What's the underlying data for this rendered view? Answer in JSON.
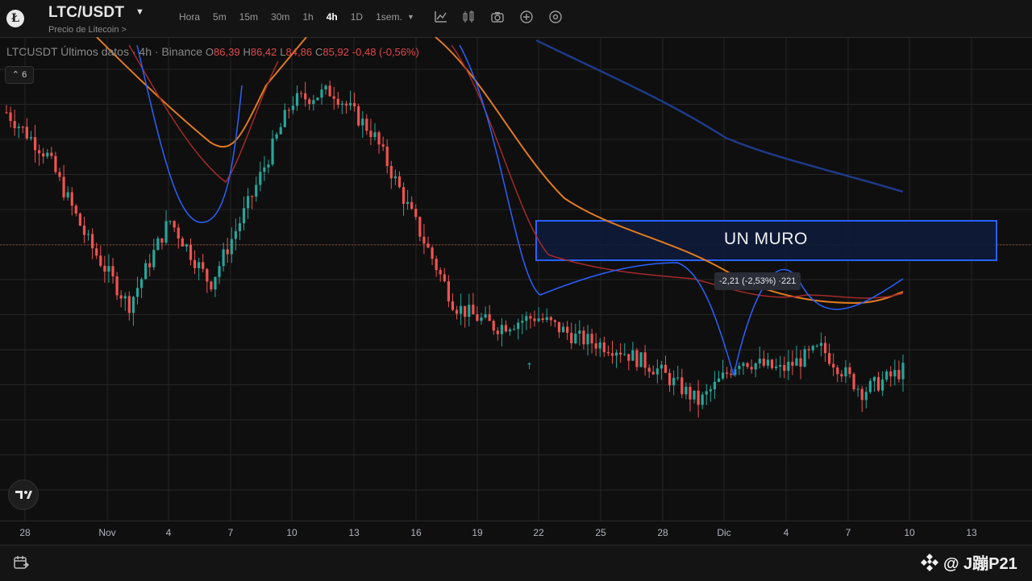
{
  "header": {
    "symbol": "LTC/USDT",
    "subtitle": "Precio de Litecoin >",
    "intervals": [
      "Hora",
      "5m",
      "15m",
      "30m",
      "1h",
      "4h",
      "1D",
      "1sem."
    ],
    "active_interval": "4h",
    "tools": [
      "indicator-icon",
      "compare-icon",
      "camera-icon",
      "add-icon",
      "settings-icon"
    ]
  },
  "legend": {
    "name": "LTCUSDT Últimos datos · 4h · Binance",
    "o_label": "O",
    "o": "86,39",
    "h_label": "H",
    "h": "86,42",
    "l_label": "L",
    "l": "84,86",
    "c_label": "C",
    "c": "85,92",
    "change": "-0,48 (-0,56%)",
    "indicator_count": "6"
  },
  "annotation": {
    "zone_label": "UN MURO",
    "measure_label": "-2,21 (-2,53%) ·221"
  },
  "watermark": {
    "text": "@ J蹦P21"
  },
  "colors": {
    "up": "#26a69a",
    "down": "#ef5350",
    "zone_border": "#2962ff",
    "zone_fill": "#0d1b3a",
    "ma_fast": "#2962ff",
    "ma_slow_red": "#a52a2a",
    "ma_orange": "#e07a1f",
    "ma_long": "#1e3a8a"
  },
  "chart_data": {
    "type": "candlestick",
    "x_ticks": [
      "28",
      "Nov",
      "4",
      "7",
      "10",
      "13",
      "16",
      "19",
      "22",
      "25",
      "28",
      "Dic",
      "4",
      "7",
      "10",
      "13"
    ],
    "series_points": [
      [
        0,
        90,
        86
      ],
      [
        1,
        86,
        78
      ],
      [
        2,
        78,
        72
      ],
      [
        3,
        72,
        80
      ],
      [
        4,
        80,
        74
      ],
      [
        5,
        74,
        82
      ],
      [
        6,
        82,
        91
      ],
      [
        7,
        91,
        92
      ],
      [
        8,
        92,
        88
      ],
      [
        9,
        88,
        80
      ],
      [
        10,
        80,
        72
      ],
      [
        11,
        72,
        70
      ],
      [
        12,
        70,
        71
      ],
      [
        13,
        71,
        69
      ],
      [
        14,
        69,
        68
      ],
      [
        15,
        68,
        66
      ],
      [
        16,
        66,
        63
      ],
      [
        17,
        63,
        67
      ],
      [
        18,
        67,
        66
      ],
      [
        19,
        66,
        68
      ],
      [
        20,
        68,
        64
      ],
      [
        21,
        64,
        66
      ],
      [
        22,
        66,
        65
      ]
    ]
  }
}
